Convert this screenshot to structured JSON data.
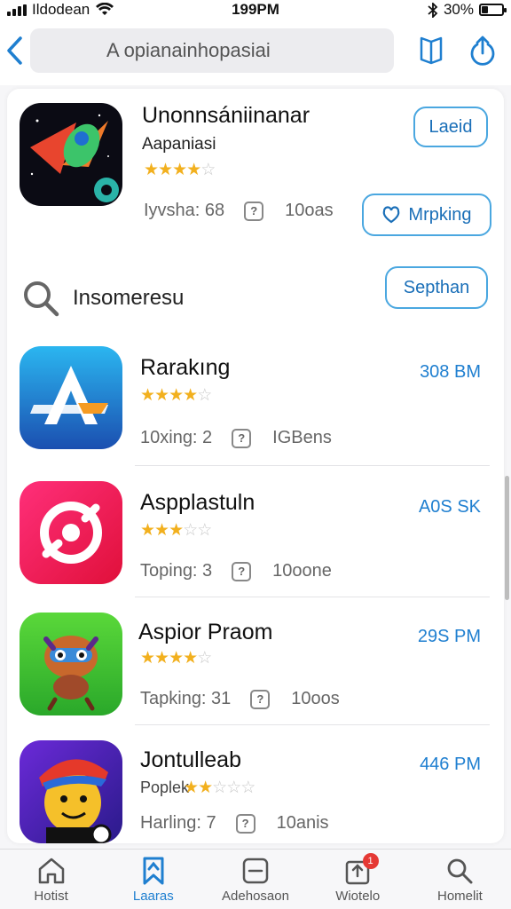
{
  "status_bar": {
    "carrier": "Ildodean",
    "time": "199PM",
    "battery": "30%",
    "battery_level": 0.3
  },
  "nav": {
    "search_text": "A opianainhopasiai",
    "icons": [
      "back-chevron-icon",
      "book-icon",
      "share-icon"
    ]
  },
  "featured": {
    "name": "Unonnsániinanar",
    "subtitle": "Aapaniasi",
    "rating": 4,
    "meta_label": "Iyvsha: 68",
    "meta_size": "10oas",
    "button_top": "Laeid",
    "button_bottom": "Mrpking"
  },
  "search_section": {
    "label": "Insomeresu",
    "button": "Septhan"
  },
  "apps": [
    {
      "name": "Rarakıng",
      "rating": 4,
      "meta_label": "10xing: 2",
      "meta_size": "IGBens",
      "size": "308 BM",
      "colors": [
        "#2bb6f0",
        "#1b4fb0"
      ]
    },
    {
      "name": "Aspplastuln",
      "rating": 3,
      "meta_label": "Toping: 3",
      "meta_size": "10oone",
      "size": "A0S SK",
      "colors": [
        "#ff2f7a",
        "#e0103a"
      ]
    },
    {
      "name": "Aspior Praom",
      "rating": 4,
      "meta_label": "Tapking: 31",
      "meta_size": "10oos",
      "size": "29S PM",
      "colors": [
        "#5ad83a",
        "#2aa82a"
      ]
    },
    {
      "name": "Jontulleab",
      "subtitle": "Poplek",
      "rating": 2,
      "meta_label": "Harling: 7",
      "meta_size": "10anis",
      "size": "446 PM",
      "colors": [
        "#6b2ad8",
        "#2a1a8a"
      ]
    }
  ],
  "tabs": [
    {
      "label": "Hotist",
      "icon": "home-icon"
    },
    {
      "label": "Laaras",
      "icon": "bookmark-icon"
    },
    {
      "label": "Adehosaon",
      "icon": "minus-square-icon"
    },
    {
      "label": "Wiotelo",
      "icon": "updates-icon",
      "badge": "1"
    },
    {
      "label": "Homelit",
      "icon": "search-icon"
    }
  ],
  "colors": {
    "accent": "#1f7fd0",
    "star": "#f2b01e",
    "badge": "#e53935"
  }
}
